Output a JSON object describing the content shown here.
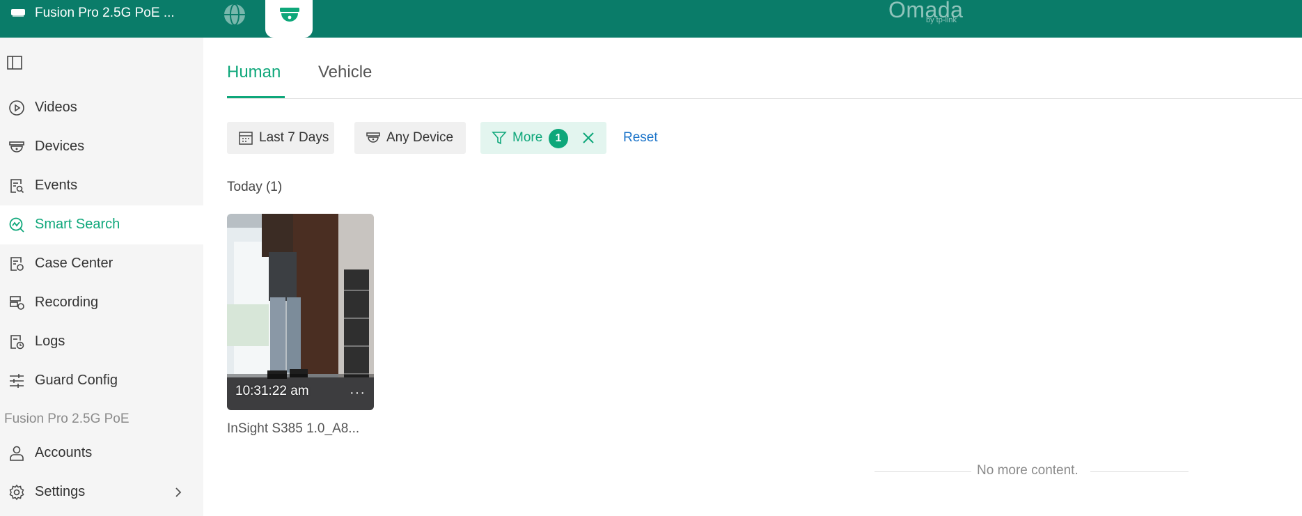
{
  "topbar": {
    "device_name": "Fusion Pro 2.5G PoE ...",
    "brand": "Omada",
    "brand_sub": "by tp-link"
  },
  "sidebar": {
    "items": [
      {
        "label": "Videos",
        "icon": "play-circle-icon"
      },
      {
        "label": "Devices",
        "icon": "camera-dome-icon"
      },
      {
        "label": "Events",
        "icon": "event-search-icon"
      },
      {
        "label": "Smart Search",
        "icon": "smart-search-icon",
        "active": true
      },
      {
        "label": "Case Center",
        "icon": "case-icon"
      },
      {
        "label": "Recording",
        "icon": "recording-icon"
      },
      {
        "label": "Logs",
        "icon": "logs-icon"
      },
      {
        "label": "Guard Config",
        "icon": "sliders-icon"
      }
    ],
    "section_label": "Fusion Pro 2.5G PoE",
    "section_items": [
      {
        "label": "Accounts",
        "icon": "user-icon"
      },
      {
        "label": "Settings",
        "icon": "gear-icon"
      }
    ]
  },
  "main": {
    "tabs": [
      {
        "label": "Human",
        "active": true
      },
      {
        "label": "Vehicle",
        "active": false
      }
    ],
    "filters": {
      "date": "Last 7 Days",
      "device": "Any Device",
      "more": "More",
      "more_count": "1",
      "reset": "Reset"
    },
    "group": {
      "title": "Today",
      "count": "(1)"
    },
    "results": [
      {
        "time": "10:31:22 am",
        "more": "···",
        "caption": "InSight S385 1.0_A8..."
      }
    ],
    "end_text": "No more content."
  },
  "colors": {
    "brand_green": "#0a7c69",
    "accent_green": "#0ea77a",
    "link_blue": "#1a73c9"
  }
}
